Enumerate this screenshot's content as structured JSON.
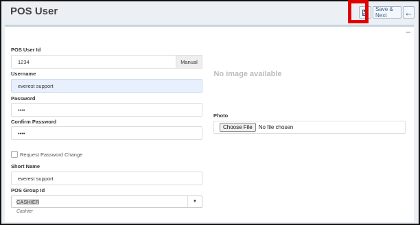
{
  "header": {
    "title": "POS User"
  },
  "toolbar": {
    "save_icon": "floppy-disk-icon",
    "save_next_label": "Save & Next",
    "back_icon": "arrow-left-icon",
    "highlight_color": "#e00000"
  },
  "form": {
    "pos_user_id": {
      "label": "POS User Id",
      "value": "1234",
      "addon": "Manual"
    },
    "username": {
      "label": "Username",
      "value": "everest support"
    },
    "password": {
      "label": "Password",
      "value": "••••"
    },
    "confirm_password": {
      "label": "Confirm Password",
      "value": "••••"
    },
    "request_password_change": {
      "label": "Request Password Change",
      "checked": false
    },
    "short_name": {
      "label": "Short Name",
      "value": "everest support"
    },
    "pos_group_id": {
      "label": "POS Group Id",
      "value": "CASHIER",
      "hint": "Cashier"
    },
    "photo": {
      "label": "Photo",
      "placeholder": "No image available",
      "choose_button": "Choose File",
      "status": "No file chosen"
    }
  },
  "box": {
    "collapse_icon": "minus-icon"
  }
}
